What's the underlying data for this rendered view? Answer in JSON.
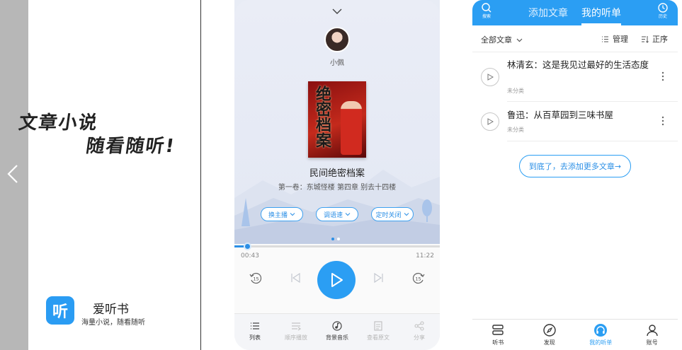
{
  "promo": {
    "slogan_line1": "文章小说",
    "slogan_line2": "随看随听!",
    "app_icon_char": "听",
    "app_name": "爱听书",
    "app_desc": "海量小说，随看随听"
  },
  "player": {
    "anchor_name": "小佩",
    "cover_title": "绝密档案",
    "book_title": "民间绝密档案",
    "chapter": "第一卷：东城怪楼 第四章 别去十四楼",
    "pills": [
      "换主播",
      "调语速",
      "定时关闭"
    ],
    "progress": {
      "current": "00:43",
      "total": "11:22",
      "fraction": 0.063
    },
    "page_dots": {
      "count": 2,
      "active": 0
    },
    "rewind_label": "15",
    "forward_label": "15",
    "nav": [
      {
        "label": "列表",
        "icon": "list-icon",
        "enabled": true
      },
      {
        "label": "顺序播放",
        "icon": "sequence-play-icon",
        "enabled": false
      },
      {
        "label": "背景音乐",
        "icon": "music-icon",
        "enabled": true
      },
      {
        "label": "查看原文",
        "icon": "document-icon",
        "enabled": false
      },
      {
        "label": "分享",
        "icon": "share-icon",
        "enabled": false
      }
    ]
  },
  "mylist": {
    "search_label": "搜索",
    "history_label": "历史",
    "tabs": [
      "添加文章",
      "我的听单"
    ],
    "active_tab": 1,
    "filter": "全部文章",
    "manage": "管理",
    "sort": "正序",
    "items": [
      {
        "title": "林清玄：这是我见过最好的生活态度",
        "category": "未分类"
      },
      {
        "title": "鲁迅：从百草园到三味书屋",
        "category": "未分类"
      }
    ],
    "end_button": "到底了，去添加更多文章→",
    "nav": [
      {
        "label": "听书",
        "icon": "book-stack-icon"
      },
      {
        "label": "发现",
        "icon": "compass-icon"
      },
      {
        "label": "我的听单",
        "icon": "headphones-icon",
        "active": true
      },
      {
        "label": "账号",
        "icon": "user-icon"
      }
    ]
  },
  "colors": {
    "accent": "#2b9ef3",
    "strip": "#b7b7b7"
  }
}
